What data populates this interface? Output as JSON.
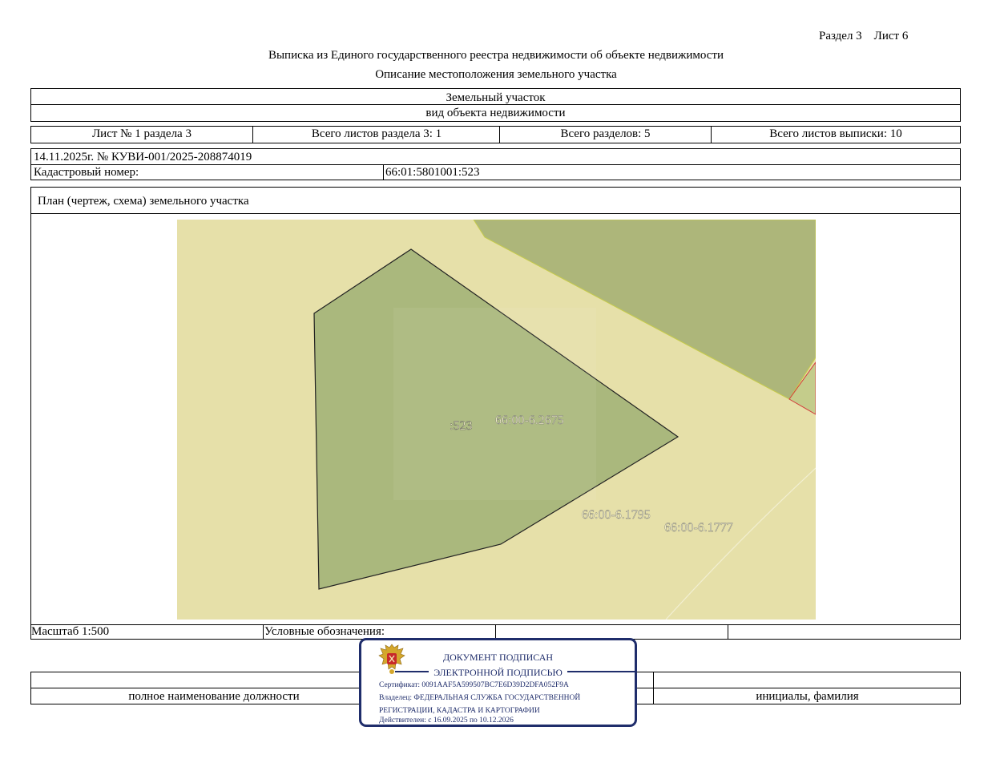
{
  "header": {
    "section_sheet": "Раздел 3    Лист 6",
    "title": "Выписка из Единого государственного реестра недвижимости об объекте недвижимости",
    "subtitle": "Описание местоположения земельного участка"
  },
  "object": {
    "type": "Земельный участок",
    "type_caption": "вид объекта недвижимости"
  },
  "sheets": {
    "sheet_of_section": "Лист № 1 раздела 3",
    "total_sheets_section": "Всего листов раздела 3: 1",
    "total_sections": "Всего разделов: 5",
    "total_sheets_extract": "Всего листов выписки: 10"
  },
  "record": {
    "date_number": "14.11.2025г. № КУВИ-001/2025-208874019",
    "cadastral_label": "Кадастровый номер:",
    "cadastral_value": "66:01:5801001:523"
  },
  "plan": {
    "title": "План (чертеж, схема) земельного участка",
    "labels": {
      "parcel": ":523",
      "zone1": "66:00-6.2675",
      "zone2": "66:00-6.1795",
      "zone3": "66:00-6.1777"
    },
    "colors": {
      "background": "#e6e0a9",
      "zone_dark": "#adb67a",
      "parcel_fill": "#aab87d",
      "label_text": "#f4f0c8",
      "red_parcel": "#d33b3b"
    }
  },
  "legend": {
    "scale": "Масштаб 1:500",
    "legend_label": "Условные обозначения:"
  },
  "signature": {
    "position_caption": "полное наименование должности",
    "initials_caption": "инициалы, фамилия"
  },
  "stamp": {
    "line1": "ДОКУМЕНТ ПОДПИСАН",
    "line2": "ЭЛЕКТРОННОЙ ПОДПИСЬЮ",
    "certificate": "Сертификат: 0091AAF5A599507BC7E6D39D2DFA052F9A",
    "owner_line1": "Владелец: ФЕДЕРАЛЬНАЯ СЛУЖБА ГОСУДАРСТВЕННОЙ",
    "owner_line2": "РЕГИСТРАЦИИ, КАДАСТРА И КАРТОГРАФИИ",
    "validity": "Действителен: с 16.09.2025 по 10.12.2026",
    "color": "#1f2d6b",
    "emblem": "russian-coat-of-arms-icon"
  }
}
